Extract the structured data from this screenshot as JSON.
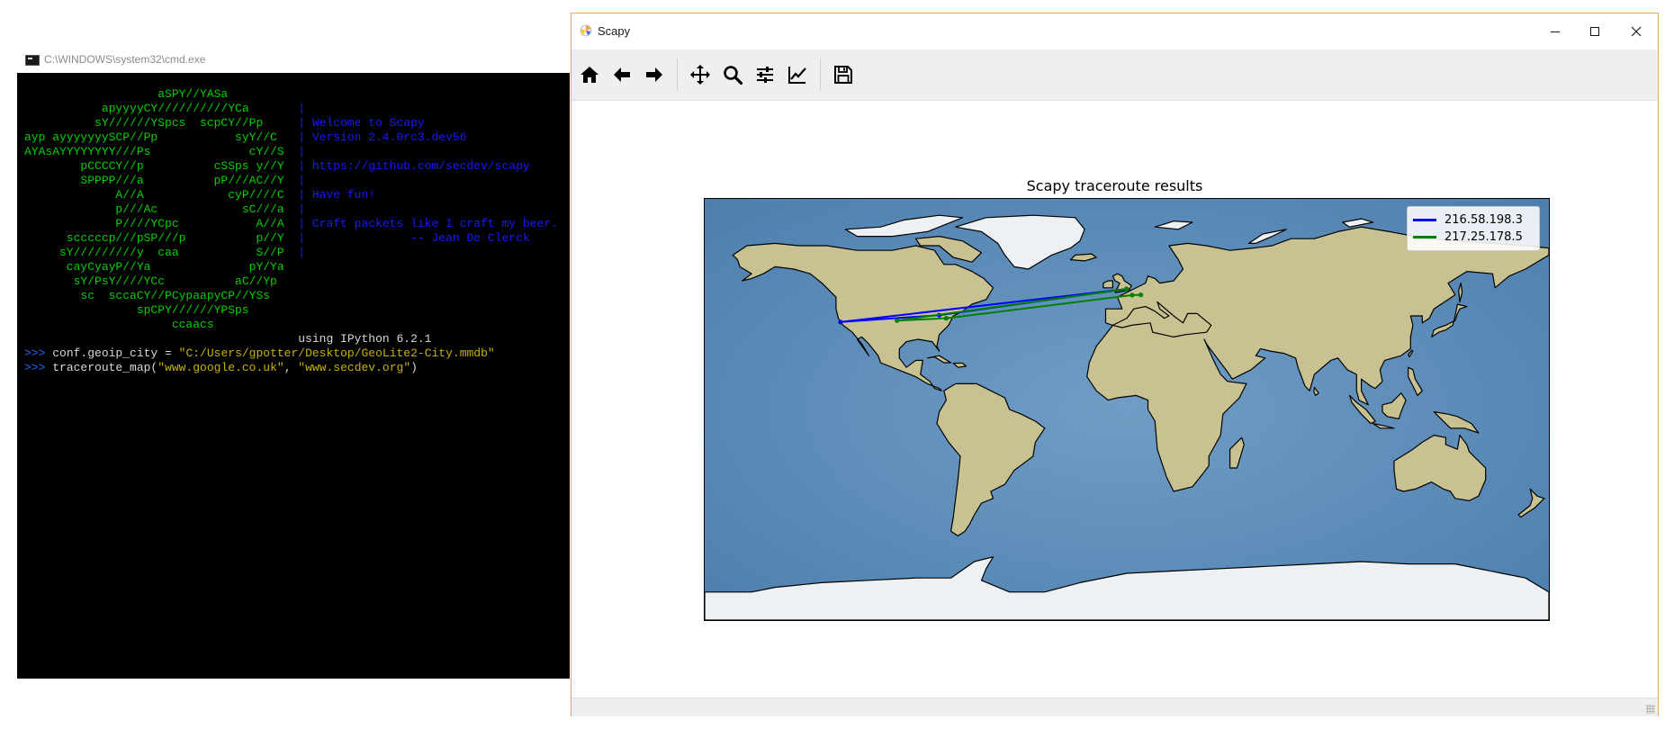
{
  "cmd_window": {
    "title": "C:\\WINDOWS\\system32\\cmd.exe",
    "lines": [
      [
        {
          "t": "                   aSPY//YASa",
          "c": "g"
        }
      ],
      [
        {
          "t": "           apyyyyCY//////////YCa       ",
          "c": "g"
        },
        {
          "t": "|",
          "c": "b"
        }
      ],
      [
        {
          "t": "          sY//////YSpcs  scpCY//Pp     ",
          "c": "g"
        },
        {
          "t": "| Welcome to Scapy",
          "c": "b"
        }
      ],
      [
        {
          "t": "ayp ayyyyyyySCP//Pp           syY//C   ",
          "c": "g"
        },
        {
          "t": "| Version 2.4.0rc3.dev56",
          "c": "b"
        }
      ],
      [
        {
          "t": "AYAsAYYYYYYYY///Ps              cY//S  ",
          "c": "g"
        },
        {
          "t": "|",
          "c": "b"
        }
      ],
      [
        {
          "t": "        pCCCCY//p          cSSps y//Y  ",
          "c": "g"
        },
        {
          "t": "| https://github.com/secdev/scapy",
          "c": "b"
        }
      ],
      [
        {
          "t": "        SPPPP///a          pP///AC//Y  ",
          "c": "g"
        },
        {
          "t": "|",
          "c": "b"
        }
      ],
      [
        {
          "t": "             A//A            cyP////C  ",
          "c": "g"
        },
        {
          "t": "| Have fun!",
          "c": "b"
        }
      ],
      [
        {
          "t": "             p///Ac            sC///a  ",
          "c": "g"
        },
        {
          "t": "|",
          "c": "b"
        }
      ],
      [
        {
          "t": "             P////YCpc           A//A  ",
          "c": "g"
        },
        {
          "t": "| Craft packets like I craft my beer.",
          "c": "b"
        }
      ],
      [
        {
          "t": "      scccccp///pSP///p          p//Y  ",
          "c": "g"
        },
        {
          "t": "|               -- Jean De Clerck",
          "c": "b"
        }
      ],
      [
        {
          "t": "     sY/////////y  caa           S//P  ",
          "c": "g"
        },
        {
          "t": "|",
          "c": "b"
        }
      ],
      [
        {
          "t": "      cayCyayP//Ya              pY/Ya",
          "c": "g"
        }
      ],
      [
        {
          "t": "       sY/PsY////YCc          aC//Yp",
          "c": "g"
        }
      ],
      [
        {
          "t": "        sc  sccaCY//PCypaapyCP//YSs",
          "c": "g"
        }
      ],
      [
        {
          "t": "                spCPY//////YPSps",
          "c": "g"
        }
      ],
      [
        {
          "t": "                     ccaacs",
          "c": "g"
        }
      ],
      [
        {
          "t": "                                       using IPython 6.2.1",
          "c": "w"
        }
      ],
      [
        {
          "t": ">>> ",
          "c": "p"
        },
        {
          "t": "conf.geoip_city = ",
          "c": "w"
        },
        {
          "t": "\"C:/Users/gpotter/Desktop/GeoLite2-City.mmdb\"",
          "c": "y"
        }
      ],
      [
        {
          "t": ">>> ",
          "c": "p"
        },
        {
          "t": "traceroute_map(",
          "c": "w"
        },
        {
          "t": "\"www.google.co.uk\"",
          "c": "y"
        },
        {
          "t": ", ",
          "c": "w"
        },
        {
          "t": "\"www.secdev.org\"",
          "c": "y"
        },
        {
          "t": ")",
          "c": "w"
        }
      ]
    ]
  },
  "scapy_window": {
    "title": "Scapy",
    "controls": {
      "minimize": "─",
      "maximize": "☐",
      "close": "✕"
    },
    "toolbar": [
      "home-icon",
      "back-arrow-icon",
      "forward-arrow-icon",
      "pan-icon",
      "zoom-icon",
      "subplots-config-icon",
      "edit-axis-icon",
      "save-icon"
    ],
    "plot": {
      "title": "Scapy traceroute results",
      "legend": [
        {
          "label": "216.58.198.3",
          "color": "#0000ff"
        },
        {
          "label": "217.25.178.5",
          "color": "#008000"
        }
      ]
    }
  },
  "chart_data": {
    "type": "map",
    "title": "Scapy traceroute results",
    "projection": "PlateCarree",
    "xlim": [
      -180,
      180
    ],
    "ylim": [
      -90,
      90
    ],
    "legend_position": "top-right",
    "series": [
      {
        "name": "216.58.198.3",
        "color": "#0000ff",
        "points": [
          [
            -0.1,
            51.5
          ],
          [
            -122.1,
            37.4
          ],
          [
            -80.0,
            40.3
          ],
          [
            -0.1,
            51.5
          ]
        ]
      },
      {
        "name": "217.25.178.5",
        "color": "#008000",
        "points": [
          [
            -0.1,
            51.5
          ],
          [
            -98.0,
            38.0
          ],
          [
            -77.0,
            39.0
          ],
          [
            2.3,
            48.9
          ],
          [
            6.0,
            49.0
          ]
        ]
      }
    ]
  }
}
